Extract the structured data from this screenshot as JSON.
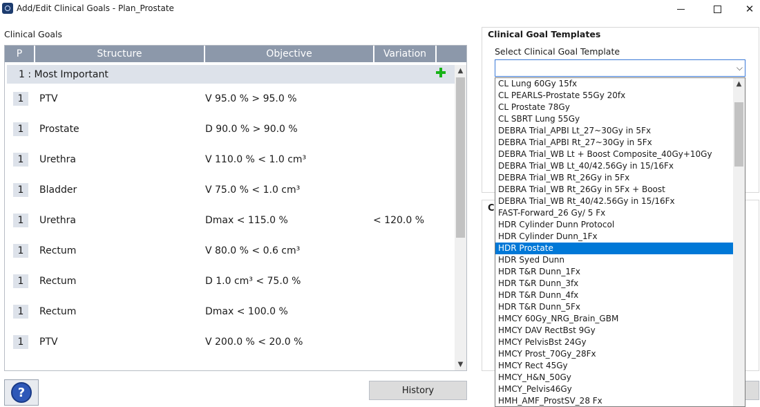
{
  "window": {
    "title": "Add/Edit Clinical Goals - Plan_Prostate",
    "minimize_glyph": "",
    "maximize_glyph": "",
    "close_glyph": "✕"
  },
  "clinical_goals": {
    "label": "Clinical Goals",
    "columns": [
      "P",
      "Structure",
      "Objective",
      "Variation",
      ""
    ],
    "group": "1 : Most Important",
    "rows": [
      {
        "priority": "1",
        "structure": "PTV",
        "objective": "V 95.0 % > 95.0 %",
        "variation": ""
      },
      {
        "priority": "1",
        "structure": "Prostate",
        "objective": "D 90.0 % > 90.0 %",
        "variation": ""
      },
      {
        "priority": "1",
        "structure": "Urethra",
        "objective": "V 110.0 % < 1.0 cm³",
        "variation": ""
      },
      {
        "priority": "1",
        "structure": "Bladder",
        "objective": "V 75.0 % < 1.0 cm³",
        "variation": ""
      },
      {
        "priority": "1",
        "structure": "Urethra",
        "objective": "Dmax < 115.0 %",
        "variation": "< 120.0 %"
      },
      {
        "priority": "1",
        "structure": "Rectum",
        "objective": "V 80.0 % < 0.6 cm³",
        "variation": ""
      },
      {
        "priority": "1",
        "structure": "Rectum",
        "objective": "D 1.0 cm³ < 75.0 %",
        "variation": ""
      },
      {
        "priority": "1",
        "structure": "Rectum",
        "objective": "Dmax < 100.0 %",
        "variation": ""
      },
      {
        "priority": "1",
        "structure": "PTV",
        "objective": "V 200.0 % < 20.0 %",
        "variation": ""
      }
    ]
  },
  "buttons": {
    "help": "?",
    "history": "History"
  },
  "templates": {
    "group_title": "Clinical Goal Templates",
    "select_label": "Select Clinical Goal Template",
    "selected_value": "",
    "second_group_letter": "C",
    "options": [
      "CL Lung 60Gy 15fx",
      "CL PEARLS-Prostate 55Gy 20fx",
      "CL Prostate 78Gy",
      "CL SBRT Lung 55Gy",
      "DEBRA Trial_APBI Lt_27~30Gy in 5Fx",
      "DEBRA Trial_APBI Rt_27~30Gy in 5Fx",
      "DEBRA Trial_WB Lt + Boost Composite_40Gy+10Gy",
      "DEBRA Trial_WB Lt_40/42.56Gy in 15/16Fx",
      "DEBRA Trial_WB Rt_26Gy in 5Fx",
      "DEBRA Trial_WB Rt_26Gy in 5Fx + Boost",
      "DEBRA Trial_WB Rt_40/42.56Gy in 15/16Fx",
      "FAST-Forward_26 Gy/ 5 Fx",
      "HDR Cylinder Dunn Protocol",
      "HDR Cylinder Dunn_1Fx",
      "HDR Prostate",
      "HDR Syed Dunn",
      "HDR T&R Dunn_1Fx",
      "HDR T&R Dunn_3fx",
      "HDR T&R Dunn_4fx",
      "HDR T&R Dunn_5Fx",
      "HMCY 60Gy_NRG_Brain_GBM",
      "HMCY DAV RectBst 9Gy",
      "HMCY PelvisBst 24Gy",
      "HMCY Prost_70Gy_28Fx",
      "HMCY Rect 45Gy",
      "HMCY_H&N_50Gy",
      "HMCY_Pelvis46Gy",
      "HMH_AMF_ProstSV_28 Fx"
    ],
    "highlighted_option": "HDR Prostate"
  },
  "colors": {
    "header_bg": "#8c98aa",
    "group_bg": "#dde2ea",
    "selection": "#0078d7",
    "add_green": "#18b318"
  }
}
